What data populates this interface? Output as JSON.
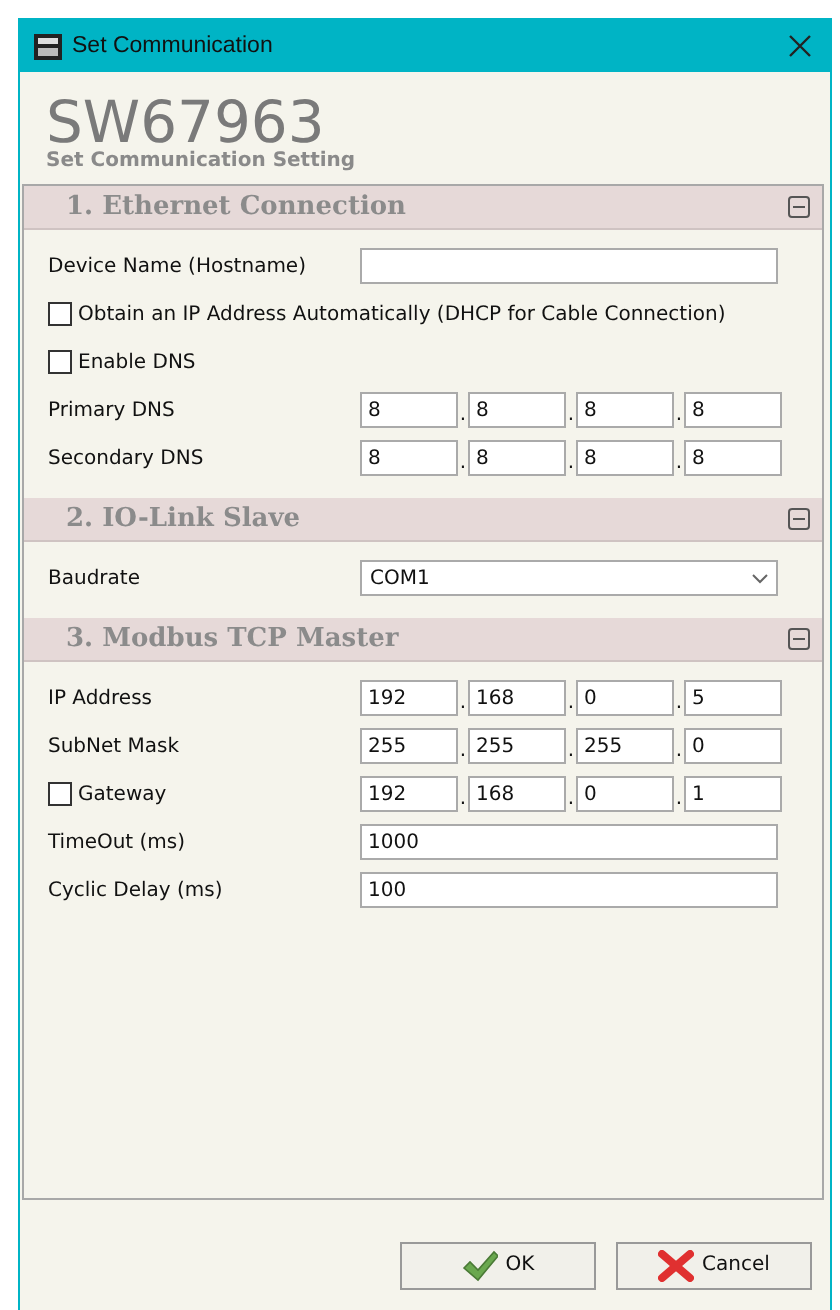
{
  "window": {
    "title": "Set Communication"
  },
  "header": {
    "title": "SW67963",
    "subtitle": "Set Communication Setting"
  },
  "sections": [
    {
      "title": "1. Ethernet Connection",
      "expanded": true,
      "rows": [
        {
          "kind": "text",
          "label": "Device Name (Hostname)",
          "value": ""
        },
        {
          "kind": "checkbox",
          "label": "Obtain an IP Address Automatically (DHCP for Cable Connection)",
          "checked": false
        },
        {
          "kind": "checkbox",
          "label": "Enable DNS",
          "checked": false
        },
        {
          "kind": "ip",
          "label": "Primary DNS",
          "octets": [
            "8",
            "8",
            "8",
            "8"
          ],
          "separators": [
            ".",
            ".",
            "."
          ]
        },
        {
          "kind": "ip",
          "label": "Secondary DNS",
          "octets": [
            "8",
            "8",
            "8",
            "8"
          ],
          "separators": [
            ".",
            ".",
            "."
          ]
        }
      ]
    },
    {
      "title": "2. IO-Link Slave",
      "expanded": true,
      "rows": [
        {
          "kind": "select",
          "label": "Baudrate",
          "value": "COM1"
        }
      ]
    },
    {
      "title": "3. Modbus TCP Master",
      "expanded": true,
      "rows": [
        {
          "kind": "ip",
          "label": "IP Address",
          "octets": [
            "192",
            "168",
            "0",
            "5"
          ],
          "separators": [
            ".",
            ".",
            "."
          ]
        },
        {
          "kind": "ip",
          "label": "SubNet Mask",
          "octets": [
            "255",
            "255",
            "255",
            "0"
          ],
          "separators": [
            ".",
            ".",
            "."
          ]
        },
        {
          "kind": "checkbox_ip",
          "label": "Gateway",
          "checked": false,
          "octets": [
            "192",
            "168",
            "0",
            "1"
          ],
          "separators": [
            ".",
            ".",
            "."
          ]
        },
        {
          "kind": "text",
          "label": "TimeOut (ms)",
          "value": "1000"
        },
        {
          "kind": "text",
          "label": "Cyclic Delay (ms)",
          "value": "100"
        }
      ]
    }
  ],
  "buttons": [
    {
      "kind": "ok",
      "label": "OK"
    },
    {
      "kind": "cancel",
      "label": "Cancel"
    }
  ]
}
